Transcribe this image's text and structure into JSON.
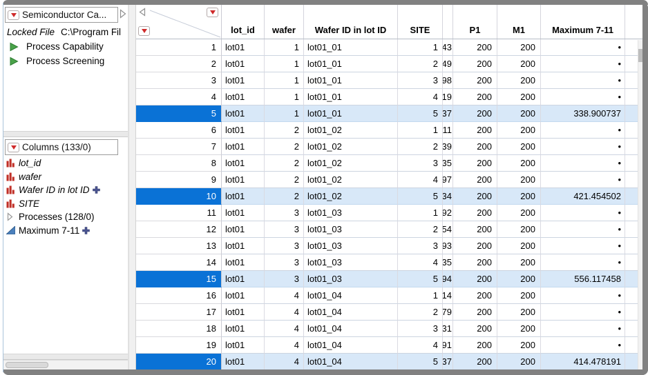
{
  "sidebar": {
    "table_panel": {
      "title": "Semiconductor Ca...",
      "locked_label": "Locked File",
      "locked_path": "C:\\Program Fil",
      "scripts": [
        "Process Capability",
        "Process Screening"
      ]
    },
    "columns_panel": {
      "title": "Columns (133/0)",
      "items": [
        {
          "label": "lot_id",
          "icon": "red-bars",
          "italic": true,
          "plus": false
        },
        {
          "label": "wafer",
          "icon": "red-bars",
          "italic": true,
          "plus": false
        },
        {
          "label": "Wafer ID in lot ID",
          "icon": "red-bars",
          "italic": true,
          "plus": true
        },
        {
          "label": "SITE",
          "icon": "red-bars",
          "italic": true,
          "plus": false
        },
        {
          "label": "Processes (128/0)",
          "icon": "gray-chevron",
          "italic": false,
          "plus": false
        },
        {
          "label": "Maximum 7-11",
          "icon": "blue-triangle",
          "italic": false,
          "plus": true
        }
      ]
    }
  },
  "table": {
    "columns": [
      {
        "label": "lot_id"
      },
      {
        "label": "wafer"
      },
      {
        "label": "Wafer ID in lot ID"
      },
      {
        "label": "SITE"
      },
      {
        "label": ""
      },
      {
        "label": "P1"
      },
      {
        "label": "M1"
      },
      {
        "label": "Maximum 7-11"
      }
    ],
    "rows": [
      {
        "n": "1",
        "lot_id": "lot01",
        "wafer": "1",
        "wafer_id": "lot01_01",
        "site": "1",
        "clip": "43",
        "p1": "200",
        "m1": "200",
        "max": "•",
        "selected": false
      },
      {
        "n": "2",
        "lot_id": "lot01",
        "wafer": "1",
        "wafer_id": "lot01_01",
        "site": "2",
        "clip": "49",
        "p1": "200",
        "m1": "200",
        "max": "•",
        "selected": false
      },
      {
        "n": "3",
        "lot_id": "lot01",
        "wafer": "1",
        "wafer_id": "lot01_01",
        "site": "3",
        "clip": "98",
        "p1": "200",
        "m1": "200",
        "max": "•",
        "selected": false
      },
      {
        "n": "4",
        "lot_id": "lot01",
        "wafer": "1",
        "wafer_id": "lot01_01",
        "site": "4",
        "clip": "19",
        "p1": "200",
        "m1": "200",
        "max": "•",
        "selected": false
      },
      {
        "n": "5",
        "lot_id": "lot01",
        "wafer": "1",
        "wafer_id": "lot01_01",
        "site": "5",
        "clip": "37",
        "p1": "200",
        "m1": "200",
        "max": "338.900737",
        "selected": true
      },
      {
        "n": "6",
        "lot_id": "lot01",
        "wafer": "2",
        "wafer_id": "lot01_02",
        "site": "1",
        "clip": "11",
        "p1": "200",
        "m1": "200",
        "max": "•",
        "selected": false
      },
      {
        "n": "7",
        "lot_id": "lot01",
        "wafer": "2",
        "wafer_id": "lot01_02",
        "site": "2",
        "clip": "39",
        "p1": "200",
        "m1": "200",
        "max": "•",
        "selected": false
      },
      {
        "n": "8",
        "lot_id": "lot01",
        "wafer": "2",
        "wafer_id": "lot01_02",
        "site": "3",
        "clip": "35",
        "p1": "200",
        "m1": "200",
        "max": "•",
        "selected": false
      },
      {
        "n": "9",
        "lot_id": "lot01",
        "wafer": "2",
        "wafer_id": "lot01_02",
        "site": "4",
        "clip": "97",
        "p1": "200",
        "m1": "200",
        "max": "•",
        "selected": false
      },
      {
        "n": "10",
        "lot_id": "lot01",
        "wafer": "2",
        "wafer_id": "lot01_02",
        "site": "5",
        "clip": "34",
        "p1": "200",
        "m1": "200",
        "max": "421.454502",
        "selected": true
      },
      {
        "n": "11",
        "lot_id": "lot01",
        "wafer": "3",
        "wafer_id": "lot01_03",
        "site": "1",
        "clip": "92",
        "p1": "200",
        "m1": "200",
        "max": "•",
        "selected": false
      },
      {
        "n": "12",
        "lot_id": "lot01",
        "wafer": "3",
        "wafer_id": "lot01_03",
        "site": "2",
        "clip": "54",
        "p1": "200",
        "m1": "200",
        "max": "•",
        "selected": false
      },
      {
        "n": "13",
        "lot_id": "lot01",
        "wafer": "3",
        "wafer_id": "lot01_03",
        "site": "3",
        "clip": "93",
        "p1": "200",
        "m1": "200",
        "max": "•",
        "selected": false
      },
      {
        "n": "14",
        "lot_id": "lot01",
        "wafer": "3",
        "wafer_id": "lot01_03",
        "site": "4",
        "clip": "35",
        "p1": "200",
        "m1": "200",
        "max": "•",
        "selected": false
      },
      {
        "n": "15",
        "lot_id": "lot01",
        "wafer": "3",
        "wafer_id": "lot01_03",
        "site": "5",
        "clip": "94",
        "p1": "200",
        "m1": "200",
        "max": "556.117458",
        "selected": true
      },
      {
        "n": "16",
        "lot_id": "lot01",
        "wafer": "4",
        "wafer_id": "lot01_04",
        "site": "1",
        "clip": "14",
        "p1": "200",
        "m1": "200",
        "max": "•",
        "selected": false
      },
      {
        "n": "17",
        "lot_id": "lot01",
        "wafer": "4",
        "wafer_id": "lot01_04",
        "site": "2",
        "clip": "79",
        "p1": "200",
        "m1": "200",
        "max": "•",
        "selected": false
      },
      {
        "n": "18",
        "lot_id": "lot01",
        "wafer": "4",
        "wafer_id": "lot01_04",
        "site": "3",
        "clip": "31",
        "p1": "200",
        "m1": "200",
        "max": "•",
        "selected": false
      },
      {
        "n": "19",
        "lot_id": "lot01",
        "wafer": "4",
        "wafer_id": "lot01_04",
        "site": "4",
        "clip": "91",
        "p1": "200",
        "m1": "200",
        "max": "•",
        "selected": false
      },
      {
        "n": "20",
        "lot_id": "lot01",
        "wafer": "4",
        "wafer_id": "lot01_04",
        "site": "5",
        "clip": "37",
        "p1": "200",
        "m1": "200",
        "max": "414.478191",
        "selected": true
      }
    ]
  },
  "colors": {
    "selected_row_header": "#0a72d6",
    "selected_cell_bg": "#d8e8f8",
    "accent_red": "#cf2a2a",
    "script_green": "#4aa34a",
    "continuous_blue": "#4b80bd"
  }
}
